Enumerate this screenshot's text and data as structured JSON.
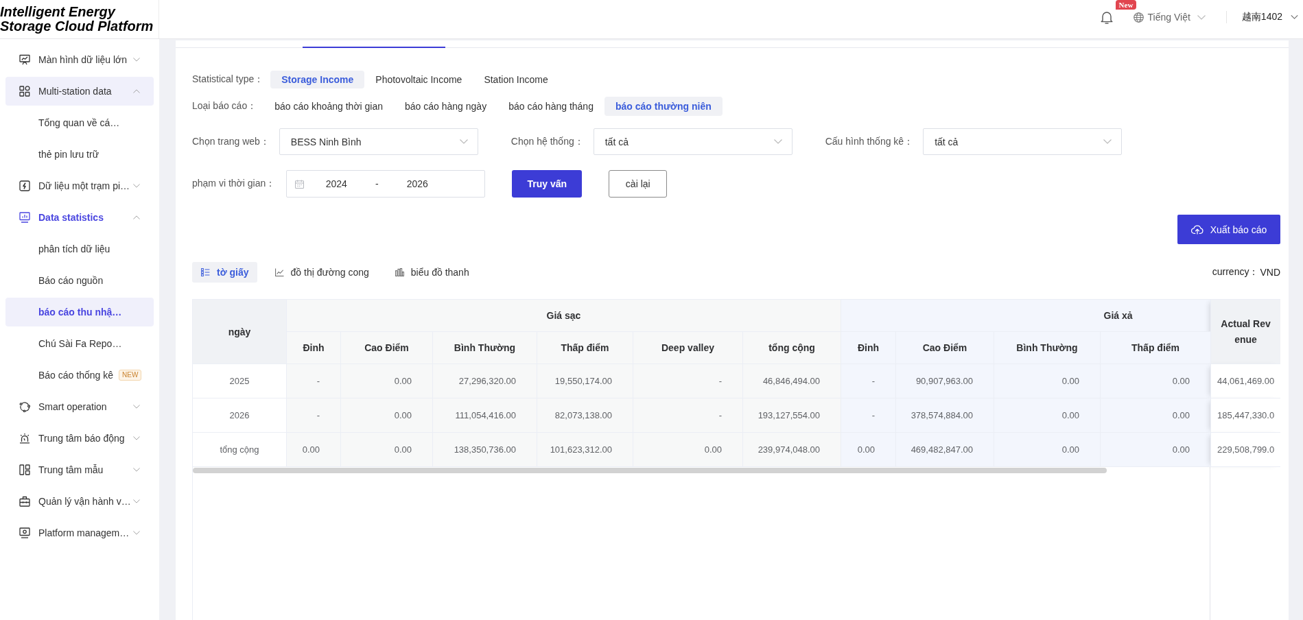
{
  "header": {
    "logo": "Intelligent Energy Storage Cloud Platform",
    "notification_badge": "New",
    "language": "Tiếng Việt",
    "user": "越南1402"
  },
  "sidebar": {
    "items": [
      {
        "label": "Màn hình dữ liệu lớn",
        "expanded": false,
        "active": false,
        "hovered": false
      },
      {
        "label": "Multi-station data",
        "expanded": true,
        "active": false,
        "hovered": true,
        "children": [
          {
            "label": "Tổng quan về cá…",
            "selected": false
          },
          {
            "label": "thẻ pin lưu trữ",
            "selected": false
          }
        ]
      },
      {
        "label": "Dữ liệu một trạm pi…",
        "expanded": false,
        "active": false,
        "hovered": false
      },
      {
        "label": "Data statistics",
        "expanded": true,
        "active": true,
        "hovered": false,
        "children": [
          {
            "label": "phân tích dữ liệu",
            "selected": false
          },
          {
            "label": "Báo cáo nguồn",
            "selected": false
          },
          {
            "label": "báo cáo thu nhậ…",
            "selected": true
          },
          {
            "label": "Chú Sài Fa Repo…",
            "selected": false
          },
          {
            "label": "Báo cáo thống kê",
            "selected": false,
            "badge": "NEW"
          }
        ]
      },
      {
        "label": "Smart operation",
        "expanded": false,
        "active": false,
        "hovered": false
      },
      {
        "label": "Trung tâm báo động",
        "expanded": false,
        "active": false,
        "hovered": false
      },
      {
        "label": "Trung tâm mẫu",
        "expanded": false,
        "active": false,
        "hovered": false
      },
      {
        "label": "Quản lý vận hành v…",
        "expanded": false,
        "active": false,
        "hovered": false
      },
      {
        "label": "Platform managem…",
        "expanded": false,
        "active": false,
        "hovered": false
      }
    ]
  },
  "filters": {
    "statistical_type": {
      "label": "Statistical type：",
      "options": [
        {
          "label": "Storage Income",
          "selected": true
        },
        {
          "label": "Photovoltaic Income",
          "selected": false
        },
        {
          "label": "Station Income",
          "selected": false
        }
      ]
    },
    "report_type": {
      "label": "Loại báo cáo：",
      "options": [
        {
          "label": "báo cáo khoảng thời gian",
          "selected": false
        },
        {
          "label": "báo cáo hàng ngày",
          "selected": false
        },
        {
          "label": "báo cáo hàng tháng",
          "selected": false
        },
        {
          "label": "báo cáo thường niên",
          "selected": true
        }
      ]
    },
    "selects": [
      {
        "label": "Chọn trang web：",
        "value": "BESS Ninh Bình"
      },
      {
        "label": "Chọn hệ thống：",
        "value": "tất cả"
      },
      {
        "label": "Cấu hình thống kê：",
        "value": "tất cả"
      }
    ],
    "time_range": {
      "label": "phạm vi thời gian：",
      "start": "2024",
      "separator": "-",
      "end": "2026"
    },
    "buttons": [
      {
        "label": "Truy vấn",
        "kind": "primary"
      },
      {
        "label": "cài lại",
        "kind": "default"
      }
    ]
  },
  "export_button": {
    "label": "Xuất báo cáo"
  },
  "view_tabs": [
    {
      "label": "tờ giấy",
      "selected": true
    },
    {
      "label": "đồ thị đường cong",
      "selected": false
    },
    {
      "label": "biểu đồ thanh",
      "selected": false
    }
  ],
  "currency": {
    "label": "currency：",
    "value": "VND"
  },
  "table": {
    "columns": [
      {
        "label": "ngày"
      },
      {
        "label": "Giá sạc",
        "colspan": 6,
        "color": "#f7f8f8",
        "children": [
          {
            "label": "Đỉnh"
          },
          {
            "label": "Cao Điểm"
          },
          {
            "label": "Bình Thường"
          },
          {
            "label": "Thấp điểm"
          },
          {
            "label": "Deep valley"
          },
          {
            "label": "tổng cộng"
          }
        ]
      },
      {
        "label": "Giá xả",
        "colspan": 4,
        "color": "#f3f6fd",
        "children": [
          {
            "label": "Đỉnh"
          },
          {
            "label": "Cao Điểm"
          },
          {
            "label": "Bình Thường"
          },
          {
            "label": "Thấp điểm"
          }
        ]
      },
      {
        "label": "Actual Revenue",
        "fixed": true
      }
    ],
    "rows": [
      {
        "cells": [
          "2025",
          "-",
          "0.00",
          "27,296,320.00",
          "19,550,174.00",
          "-",
          "46,846,494.00",
          "-",
          "90,907,963.00",
          "0.00",
          "0.00",
          "44,061,469.00"
        ]
      },
      {
        "cells": [
          "2026",
          "-",
          "0.00",
          "111,054,416.00",
          "82,073,138.00",
          "-",
          "193,127,554.00",
          "-",
          "378,574,884.00",
          "0.00",
          "0.00",
          "185,447,330.0"
        ]
      },
      {
        "cells": [
          "tổng cộng",
          "0.00",
          "0.00",
          "138,350,736.00",
          "101,623,312.00",
          "0.00",
          "239,974,048.00",
          "0.00",
          "469,482,847.00",
          "0.00",
          "0.00",
          "229,508,799.0"
        ]
      }
    ]
  }
}
